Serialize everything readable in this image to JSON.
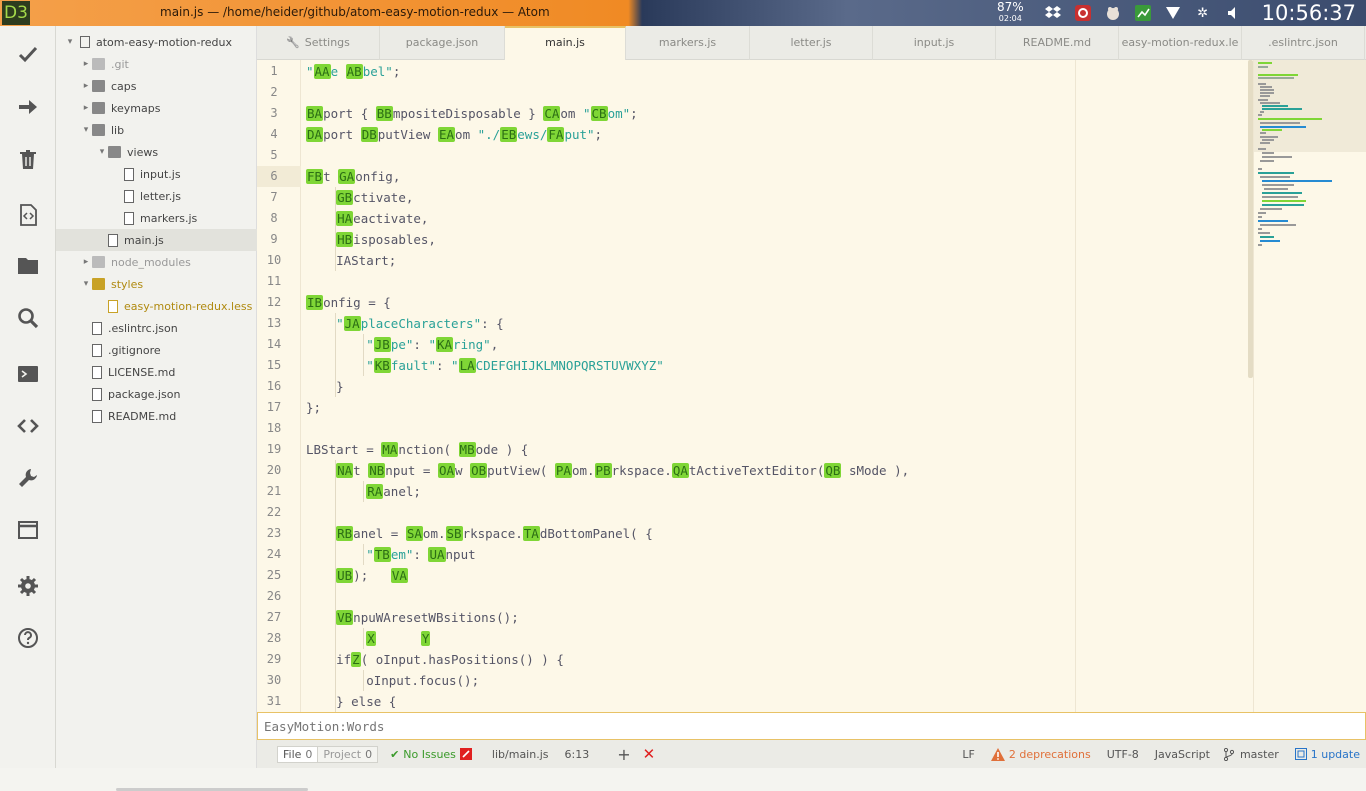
{
  "os": {
    "workspace": "D3",
    "window_title": "main.js — /home/heider/github/atom-easy-motion-redux — Atom",
    "battery_percent": "87%",
    "battery_time": "02:04",
    "clock": "10:56:37",
    "tray_icons": [
      "dropbox-icon",
      "network-manager-icon",
      "app-icon",
      "chart-icon",
      "wifi-icon",
      "settings-icon",
      "volume-icon"
    ]
  },
  "dock": {
    "buttons": [
      "checkmark-icon",
      "arrow-right-icon",
      "trash-icon",
      "code-file-icon",
      "folder-icon",
      "search-icon",
      "terminal-icon",
      "code-brackets-icon",
      "wrench-icon",
      "window-icon",
      "gear-icon",
      "help-icon"
    ]
  },
  "tree": {
    "root": "atom-easy-motion-redux",
    "items": [
      {
        "label": ".git",
        "kind": "folder",
        "state": "collapsed",
        "depth": 1,
        "dim": true
      },
      {
        "label": "caps",
        "kind": "folder",
        "state": "collapsed",
        "depth": 1
      },
      {
        "label": "keymaps",
        "kind": "folder",
        "state": "collapsed",
        "depth": 1
      },
      {
        "label": "lib",
        "kind": "folder",
        "state": "expanded",
        "depth": 1
      },
      {
        "label": "views",
        "kind": "folder",
        "state": "expanded",
        "depth": 2
      },
      {
        "label": "input.js",
        "kind": "file",
        "depth": 3
      },
      {
        "label": "letter.js",
        "kind": "file",
        "depth": 3
      },
      {
        "label": "markers.js",
        "kind": "file",
        "depth": 3
      },
      {
        "label": "main.js",
        "kind": "file",
        "depth": 2,
        "selected": true
      },
      {
        "label": "node_modules",
        "kind": "folder",
        "state": "collapsed",
        "depth": 1,
        "dim": true
      },
      {
        "label": "styles",
        "kind": "folder",
        "state": "expanded",
        "depth": 1,
        "modified": true
      },
      {
        "label": "easy-motion-redux.less",
        "kind": "file",
        "depth": 2,
        "modified": true
      },
      {
        "label": ".eslintrc.json",
        "kind": "file",
        "depth": 1
      },
      {
        "label": ".gitignore",
        "kind": "file",
        "depth": 1
      },
      {
        "label": "LICENSE.md",
        "kind": "file",
        "depth": 1
      },
      {
        "label": "package.json",
        "kind": "file",
        "depth": 1
      },
      {
        "label": "README.md",
        "kind": "file",
        "depth": 1
      }
    ]
  },
  "tabs": [
    {
      "label": "Settings",
      "icon": "wrench-icon"
    },
    {
      "label": "package.json"
    },
    {
      "label": "main.js",
      "active": true
    },
    {
      "label": "markers.js"
    },
    {
      "label": "letter.js"
    },
    {
      "label": "input.js"
    },
    {
      "label": "README.md"
    },
    {
      "label": "easy-motion-redux.le"
    },
    {
      "label": ".eslintrc.json"
    }
  ],
  "editor": {
    "current_line": 6,
    "lines": [
      "\"AAe ABbel\";",
      "",
      "BAport { BBmpositeDisposable } CAom \"CBom\";",
      "DAport DBputView EAom \"./EBews/FAput\";",
      "",
      "FBt GAonfig,",
      "    GBctivate,",
      "    HAeactivate,",
      "    HBisposables,",
      "    IAStart;",
      "",
      "IBonfig = {",
      "    \"JAplaceCharacters\": {",
      "        \"JBpe\": \"KAring\",",
      "        \"KBfault\": \"LACDEFGHIJKLMNOPQRSTUVWXYZ\"",
      "    }",
      "};",
      "",
      "LBStart = MAnction( MBode ) {",
      "    NAt NBnput = OAw OBputView( PAom.PBrkspace.QAtActiveTextEditor(QB sMode ),",
      "        RAanel;",
      "",
      "    RBanel = SAom.SBrkspace.TAdBottomPanel( {",
      "        \"TBem\": UAnput",
      "    UB);   VA",
      "",
      "    VBnpuWAresetWBsitions();",
      "        X      Y",
      "    ifZ( oInput.hasPositions() ) {",
      "        oInput.focus();",
      "    } else {"
    ]
  },
  "motion_input": {
    "placeholder": "EasyMotion:Words"
  },
  "status": {
    "file_label": "File",
    "file_count": "0",
    "project_label": "Project",
    "project_count": "0",
    "issues": "No Issues",
    "path": "lib/main.js",
    "cursor": "6:13",
    "line_ending": "LF",
    "deprecations": "2 deprecations",
    "encoding": "UTF-8",
    "grammar": "JavaScript",
    "branch": "master",
    "updates": "1 update"
  },
  "colors": {
    "hint_bg": "#7fd636",
    "hint_fg": "#2c6f14",
    "tab_accent": "#e8c266",
    "editor_bg": "#fdf8e8",
    "ok_green": "#3a9a2a",
    "error_red": "#e02020",
    "warning": "#e0703a",
    "link_blue": "#2874c8"
  }
}
